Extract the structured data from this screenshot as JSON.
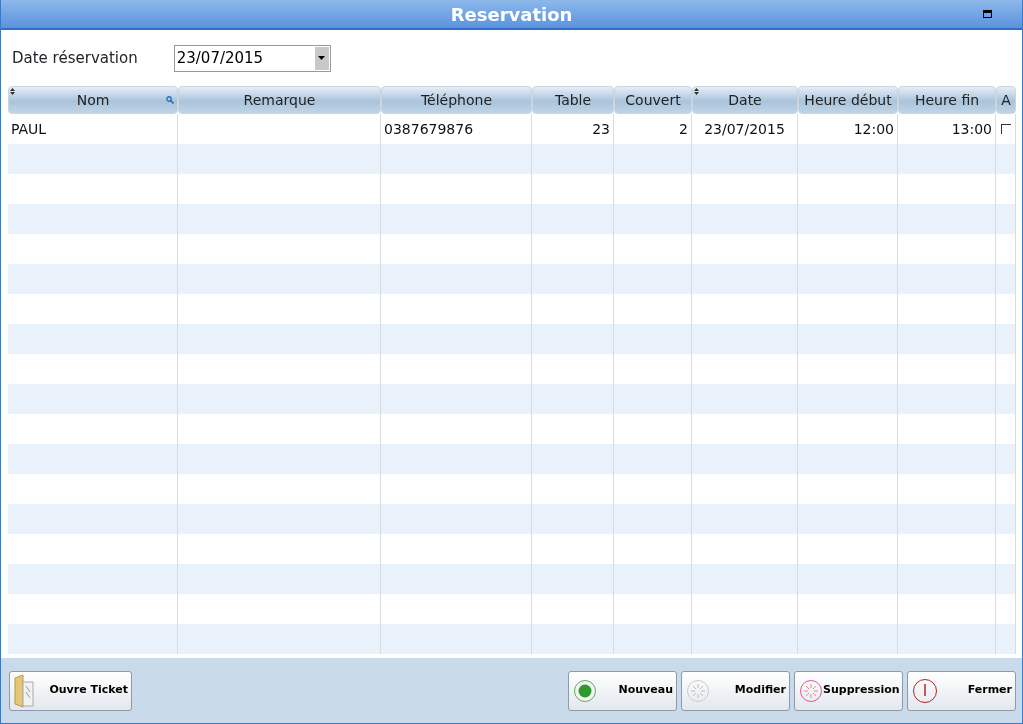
{
  "window": {
    "title": "Reservation"
  },
  "date_field": {
    "label": "Date réservation",
    "value": "23/07/2015"
  },
  "table": {
    "columns": [
      {
        "label": "Nom",
        "sortable": true,
        "searchable": true
      },
      {
        "label": "Remarque",
        "sortable": false,
        "searchable": false
      },
      {
        "label": "Téléphone",
        "sortable": false,
        "searchable": false
      },
      {
        "label": "Table",
        "sortable": false,
        "searchable": false
      },
      {
        "label": "Couvert",
        "sortable": false,
        "searchable": false
      },
      {
        "label": "Date",
        "sortable": true,
        "searchable": false
      },
      {
        "label": "Heure début",
        "sortable": false,
        "searchable": false
      },
      {
        "label": "Heure fin",
        "sortable": false,
        "searchable": false
      },
      {
        "label": "A",
        "sortable": false,
        "searchable": false
      }
    ],
    "rows": [
      {
        "cells": [
          "PAUL",
          "",
          "0387679876",
          "23",
          "2",
          "23/07/2015",
          "12:00",
          "13:00"
        ],
        "checked": false
      }
    ]
  },
  "buttons_left": [
    {
      "label": "Ouvre Ticket",
      "kind": "folder"
    }
  ],
  "buttons_right": [
    {
      "label": "Nouveau",
      "kind": "green"
    },
    {
      "label": "Modifier",
      "kind": "grey"
    },
    {
      "label": "Suppression",
      "kind": "red"
    },
    {
      "label": "Fermer",
      "kind": "power"
    }
  ]
}
